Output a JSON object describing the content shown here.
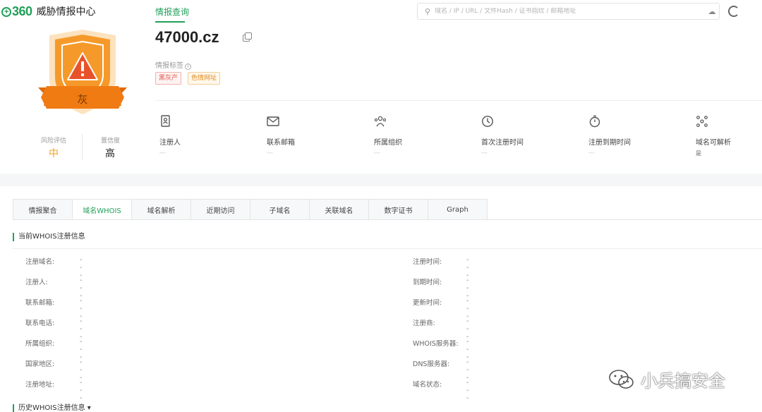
{
  "header": {
    "logo_mark": "360",
    "logo_text": "威胁情报中心",
    "nav_tab": "情报查询",
    "search_placeholder": "域名 / IP / URL / 文件Hash / 证书指纹 / 邮箱地址"
  },
  "badge": {
    "level_text": "灰",
    "colors": {
      "shield": "#f59a2a",
      "ribbon": "#f07b12",
      "alert": "#e8522a"
    }
  },
  "risk": {
    "assessment_label": "风险评估",
    "assessment_value": "中",
    "assessment_color": "#f0a020",
    "confidence_label": "置信度",
    "confidence_value": "高"
  },
  "domain": {
    "name": "47000.cz",
    "tags_title": "情报标签",
    "tags": [
      "黑灰产",
      "色情网址"
    ]
  },
  "meta": [
    {
      "icon": "id-card-icon",
      "label": "注册人",
      "value": "---"
    },
    {
      "icon": "mail-icon",
      "label": "联系邮箱",
      "value": "---"
    },
    {
      "icon": "organization-icon",
      "label": "所属组织",
      "value": "---"
    },
    {
      "icon": "clock-icon",
      "label": "首次注册时间",
      "value": "---"
    },
    {
      "icon": "timer-icon",
      "label": "注册到期时间",
      "value": "---"
    },
    {
      "icon": "resolve-icon",
      "label": "域名可解析",
      "value": "是"
    }
  ],
  "tabs": [
    "情报聚合",
    "域名WHOIS",
    "域名解析",
    "近期访问",
    "子域名",
    "关联域名",
    "数字证书",
    "Graph"
  ],
  "whois": {
    "title": "当前WHOIS注册信息",
    "left": [
      {
        "label": "注册域名:",
        "value": "---"
      },
      {
        "label": "注册人:",
        "value": "---"
      },
      {
        "label": "联系邮箱:",
        "value": "---"
      },
      {
        "label": "联系电话:",
        "value": "---"
      },
      {
        "label": "所属组织:",
        "value": "---"
      },
      {
        "label": "国家地区:",
        "value": "---"
      },
      {
        "label": "注册地址:",
        "value": "---"
      }
    ],
    "right": [
      {
        "label": "注册时间:",
        "value": "---"
      },
      {
        "label": "到期时间:",
        "value": "---"
      },
      {
        "label": "更新时间:",
        "value": "---"
      },
      {
        "label": "注册商:",
        "value": "---"
      },
      {
        "label": "WHOIS服务器:",
        "value": "---"
      },
      {
        "label": "DNS服务器:",
        "value": "---"
      },
      {
        "label": "域名状态:",
        "value": "---"
      }
    ],
    "history_title": "历史WHOIS注册信息 ▾"
  },
  "watermark": {
    "text": "小兵搞安全"
  }
}
